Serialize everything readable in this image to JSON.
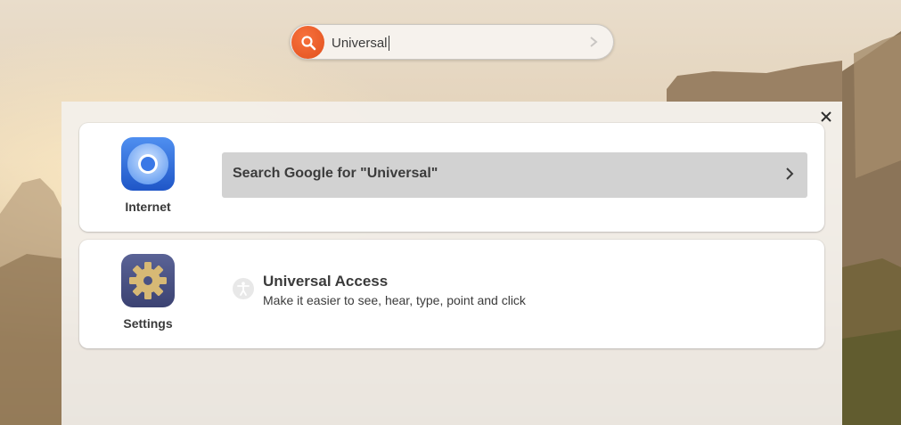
{
  "search": {
    "value": "Universal",
    "icon": "search-icon"
  },
  "overlay": {
    "close_icon": "close-icon"
  },
  "providers": [
    {
      "app_name": "Internet",
      "icon": "chromium-browser-icon",
      "result": {
        "label": "Search Google for \"Universal\"",
        "icon": "chevron-right-icon"
      }
    },
    {
      "app_name": "Settings",
      "icon": "settings-gear-icon",
      "result": {
        "title": "Universal Access",
        "description": "Make it easier to see, hear, type, point and click",
        "icon": "accessibility-icon"
      }
    }
  ],
  "colors": {
    "accent": "#e95420",
    "highlight": "#d2d2d2"
  }
}
